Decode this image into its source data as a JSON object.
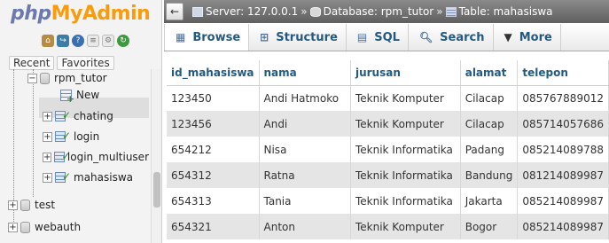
{
  "nav": {
    "logo": {
      "php": "php",
      "my": "My",
      "admin": "Admin"
    },
    "icons": [
      "home-icon",
      "exit-icon",
      "help-icon",
      "documentation-icon",
      "settings-icon",
      "reload-icon"
    ],
    "tabs": {
      "recent": "Recent",
      "favorites": "Favorites"
    },
    "tree": {
      "current_db": "rpm_tutor",
      "new_label": "New",
      "tables": [
        "chating",
        "login",
        "login_multiuser",
        "mahasiswa"
      ],
      "selected_table": "mahasiswa",
      "other_dbs": [
        "test",
        "webauth"
      ]
    }
  },
  "breadcrumb": {
    "server_label": "Server: 127.0.0.1",
    "database_label": "Database: rpm_tutor",
    "table_label": "Table: mahasiswa",
    "separator": "»"
  },
  "tabs": [
    {
      "label": "Browse",
      "icon": "browse-icon",
      "active": true
    },
    {
      "label": "Structure",
      "icon": "structure-icon",
      "active": false
    },
    {
      "label": "SQL",
      "icon": "sql-icon",
      "active": false
    },
    {
      "label": "Search",
      "icon": "search-icon",
      "active": false
    },
    {
      "label": "More",
      "icon": "chevron-down-icon",
      "active": false
    }
  ],
  "table": {
    "columns": [
      "id_mahasiswa",
      "nama",
      "jurusan",
      "alamat",
      "telepon"
    ],
    "rows": [
      [
        "123450",
        "Andi Hatmoko",
        "Teknik Komputer",
        "Cilacap",
        "085767889012"
      ],
      [
        "123456",
        "Andi",
        "Teknik Komputer",
        "Cilacap",
        "085714057686"
      ],
      [
        "654212",
        "Nisa",
        "Teknik Informatika",
        "Padang",
        "085214089788"
      ],
      [
        "654312",
        "Ratna",
        "Teknik Informatika",
        "Bandung",
        "081214089987"
      ],
      [
        "654313",
        "Tania",
        "Teknik Informatika",
        "Jakarta",
        "085214089987"
      ],
      [
        "654321",
        "Anton",
        "Teknik Komputer",
        "Bogor",
        "085214089987"
      ]
    ]
  }
}
